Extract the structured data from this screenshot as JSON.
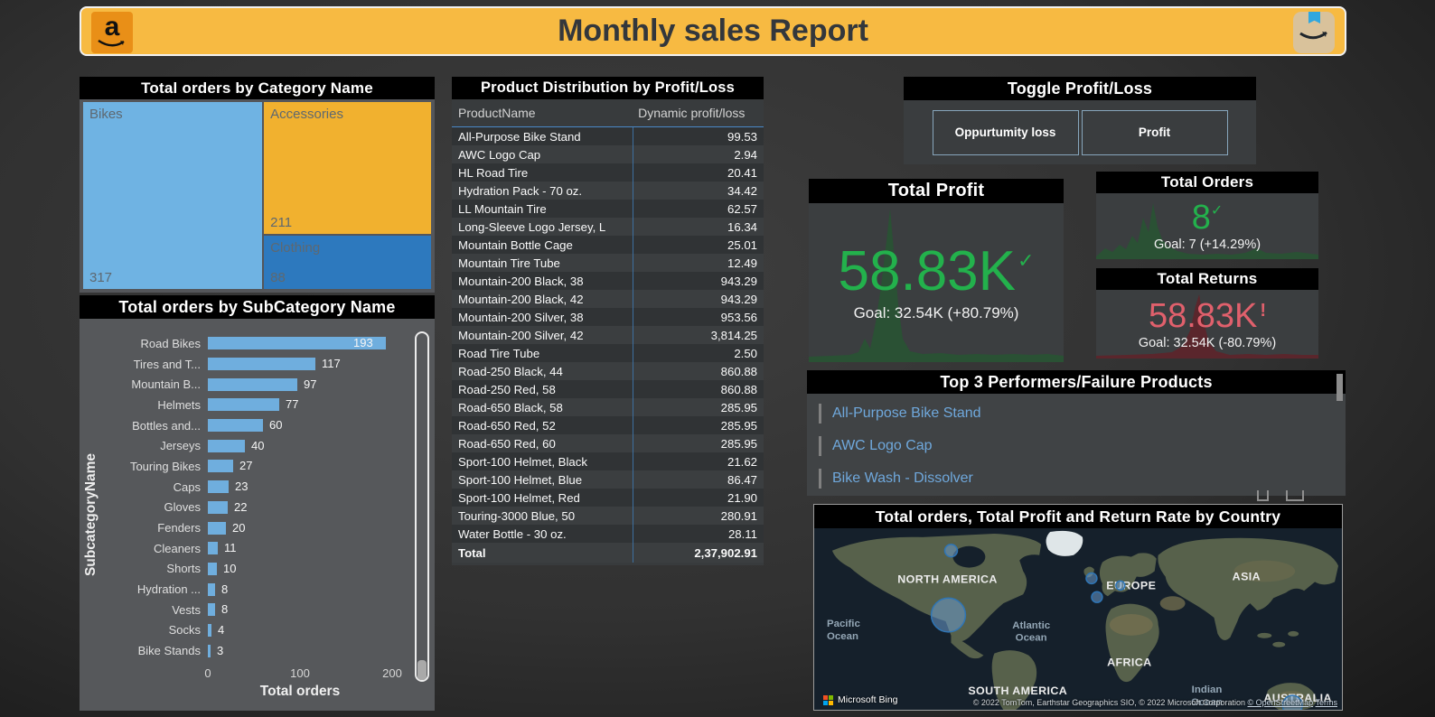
{
  "header": {
    "title": "Monthly sales Report"
  },
  "toggle": {
    "title": "Toggle Profit/Loss",
    "buttons": [
      "Oppurtumity loss",
      "Profit"
    ]
  },
  "kpis": {
    "profit": {
      "title": "Total Profit",
      "value": "58.83K",
      "status_icon": "✓",
      "goal": "Goal: 32.54K (+80.79%)",
      "value_color": "#23B14C"
    },
    "orders": {
      "title": "Total Orders",
      "value": "8",
      "status_icon": "✓",
      "goal": "Goal: 7 (+14.29%)",
      "value_color": "#23B14C"
    },
    "returns": {
      "title": "Total Returns",
      "value": "58.83K",
      "status_icon": "!",
      "goal": "Goal: 32.54K (-80.79%)",
      "value_color": "#E0606C"
    }
  },
  "top3": {
    "title": "Top 3 Performers/Failure Products",
    "items": [
      "All-Purpose Bike Stand",
      "AWC Logo Cap",
      "Bike Wash - Dissolver"
    ]
  },
  "map": {
    "title": "Total orders, Total Profit and Return Rate by Country",
    "continent_labels": [
      "NORTH AMERICA",
      "EUROPE",
      "ASIA",
      "AFRICA",
      "SOUTH AMERICA",
      "AUSTRALIA"
    ],
    "ocean_labels": [
      {
        "line1": "Pacific",
        "line2": "Ocean"
      },
      {
        "line1": "Atlantic",
        "line2": "Ocean"
      },
      {
        "line1": "Indian",
        "line2": "Ocean"
      }
    ],
    "attribution": {
      "provider": "Microsoft Bing",
      "copyright": "© 2022 TomTom, Earthstar Geographics SIO, © 2022 Microsoft Corporation",
      "osm_link": "© OpenStreetMap",
      "terms_link": "Terms"
    }
  },
  "chart_data": [
    {
      "type": "treemap",
      "title": "Total orders by Category Name",
      "categories": [
        "Bikes",
        "Accessories",
        "Clothing"
      ],
      "values": [
        317,
        211,
        88
      ],
      "colors": [
        "#6FB3E3",
        "#F1B12F",
        "#2D79BE"
      ]
    },
    {
      "type": "bar",
      "orientation": "horizontal",
      "title": "Total orders by SubCategory Name",
      "xlabel": "Total orders",
      "ylabel": "SubcategoryName",
      "xlim": [
        0,
        200
      ],
      "x_ticks": [
        0,
        100,
        200
      ],
      "bar_color": "#6FAEDE",
      "categories": [
        "Road Bikes",
        "Tires and T...",
        "Mountain B...",
        "Helmets",
        "Bottles and...",
        "Jerseys",
        "Touring Bikes",
        "Caps",
        "Gloves",
        "Fenders",
        "Cleaners",
        "Shorts",
        "Hydration ...",
        "Vests",
        "Socks",
        "Bike Stands"
      ],
      "values": [
        193,
        117,
        97,
        77,
        60,
        40,
        27,
        23,
        22,
        20,
        11,
        10,
        8,
        8,
        4,
        3
      ]
    },
    {
      "type": "table",
      "title": "Product Distribution by Profit/Loss",
      "columns": [
        "ProductName",
        "Dynamic profit/loss"
      ],
      "rows": [
        [
          "All-Purpose Bike Stand",
          "99.53"
        ],
        [
          "AWC Logo Cap",
          "2.94"
        ],
        [
          "HL Road Tire",
          "20.41"
        ],
        [
          "Hydration Pack - 70 oz.",
          "34.42"
        ],
        [
          "LL Mountain Tire",
          "62.57"
        ],
        [
          "Long-Sleeve Logo Jersey, L",
          "16.34"
        ],
        [
          "Mountain Bottle Cage",
          "25.01"
        ],
        [
          "Mountain Tire Tube",
          "12.49"
        ],
        [
          "Mountain-200 Black, 38",
          "943.29"
        ],
        [
          "Mountain-200 Black, 42",
          "943.29"
        ],
        [
          "Mountain-200 Silver, 38",
          "953.56"
        ],
        [
          "Mountain-200 Silver, 42",
          "3,814.25"
        ],
        [
          "Road Tire Tube",
          "2.50"
        ],
        [
          "Road-250 Black, 44",
          "860.88"
        ],
        [
          "Road-250 Red, 58",
          "860.88"
        ],
        [
          "Road-650 Black, 58",
          "285.95"
        ],
        [
          "Road-650 Red, 52",
          "285.95"
        ],
        [
          "Road-650 Red, 60",
          "285.95"
        ],
        [
          "Sport-100 Helmet, Black",
          "21.62"
        ],
        [
          "Sport-100 Helmet, Blue",
          "86.47"
        ],
        [
          "Sport-100 Helmet, Red",
          "21.90"
        ],
        [
          "Touring-3000 Blue, 50",
          "280.91"
        ],
        [
          "Water Bottle - 30 oz.",
          "28.11"
        ]
      ],
      "total_row": [
        "Total",
        "2,37,902.91"
      ]
    },
    {
      "type": "scatter",
      "subtype": "bubble-map",
      "title": "Total orders, Total Profit and Return Rate by Country",
      "bubbles": [
        {
          "region": "Canada",
          "size": "small",
          "x": 152,
          "y": 25,
          "r": 7
        },
        {
          "region": "United States",
          "size": "large",
          "x": 149,
          "y": 97,
          "r": 19
        },
        {
          "region": "United Kingdom",
          "size": "small",
          "x": 308,
          "y": 56,
          "r": 6
        },
        {
          "region": "Western Europe",
          "size": "small",
          "x": 340,
          "y": 64,
          "r": 5
        },
        {
          "region": "France",
          "size": "small",
          "x": 314,
          "y": 77,
          "r": 6
        },
        {
          "region": "Australia",
          "size": "medium",
          "x": 531,
          "y": 198,
          "r": 11
        }
      ]
    }
  ]
}
